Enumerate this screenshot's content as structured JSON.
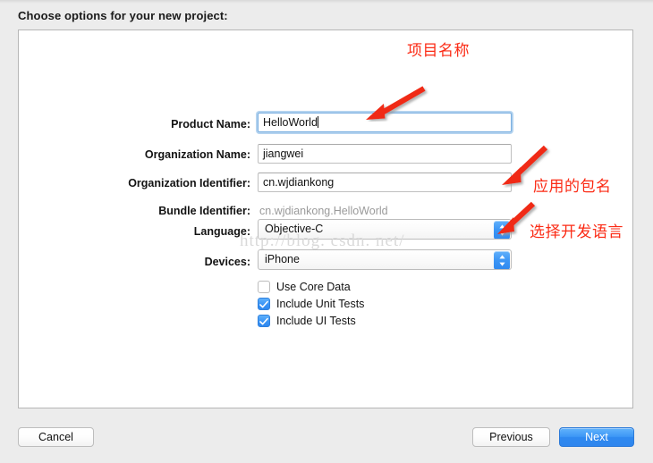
{
  "sheet": {
    "title": "Choose options for your new project:"
  },
  "form": {
    "fields": [
      {
        "label": "Product Name:",
        "value": "HelloWorld",
        "type": "text",
        "focused": true
      },
      {
        "label": "Organization Name:",
        "value": "jiangwei",
        "type": "text",
        "focused": false
      },
      {
        "label": "Organization Identifier:",
        "value": "cn.wjdiankong",
        "type": "text",
        "focused": false
      },
      {
        "label": "Bundle Identifier:",
        "value": "cn.wjdiankong.HelloWorld",
        "type": "static",
        "focused": false
      },
      {
        "label": "Language:",
        "value": "Objective-C",
        "type": "popup",
        "focused": false
      },
      {
        "label": "Devices:",
        "value": "iPhone",
        "type": "popup",
        "focused": false
      }
    ],
    "checkboxes": [
      {
        "label": "Use Core Data",
        "checked": false
      },
      {
        "label": "Include Unit Tests",
        "checked": true
      },
      {
        "label": "Include UI Tests",
        "checked": true
      }
    ]
  },
  "annotations": [
    {
      "text": "项目名称",
      "icon": "arrow-down-left-icon"
    },
    {
      "text": "应用的包名",
      "icon": "arrow-down-left-icon"
    },
    {
      "text": "选择开发语言",
      "icon": "arrow-down-left-icon"
    }
  ],
  "watermark": {
    "text": "http://blog. csdn. net/"
  },
  "footer": {
    "cancel_label": "Cancel",
    "previous_label": "Previous",
    "next_label": "Next"
  },
  "colors": {
    "accent": "#2f88ef",
    "annotation": "#fb2a14",
    "panel_bg": "#ffffff",
    "window_bg": "#ececec",
    "disabled_text": "#9a9a9a"
  }
}
